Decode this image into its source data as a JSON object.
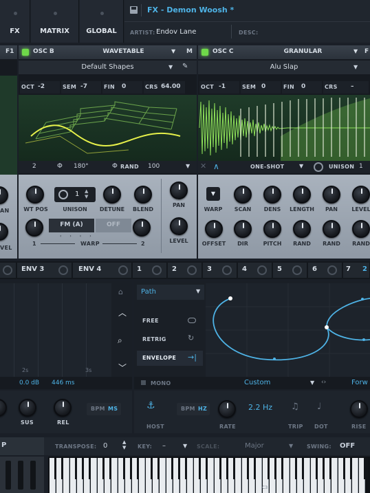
{
  "top_tabs": [
    {
      "label": "FX"
    },
    {
      "label": "MATRIX"
    },
    {
      "label": "GLOBAL"
    }
  ],
  "preset": {
    "name": "FX - Demon Woosh *",
    "artist_label": "ARTIST:",
    "artist": "Endov Lane",
    "desc_label": "DESC:"
  },
  "osc_left": {
    "f_label": "F1"
  },
  "osc_b": {
    "title": "OSC B",
    "type": "WAVETABLE",
    "m": "M",
    "wavetable": "Default Shapes",
    "oct_label": "OCT",
    "oct": "-2",
    "sem_label": "SEM",
    "sem": "-7",
    "fin_label": "FIN",
    "fin": "0",
    "crs_label": "CRS",
    "crs": "64.00",
    "unison_voices": "2",
    "phase": "180°",
    "rand_label": "RAND",
    "rand": "100",
    "knobs": [
      "WT POS",
      "UNISON",
      "DETUNE",
      "BLEND",
      "PAN",
      "LEVEL"
    ],
    "unison_count": "1",
    "warp_label": "WARP",
    "warp_mode_1": "FM (A)",
    "warp_mode_2": "OFF",
    "warp_1": "1",
    "warp_2": "2"
  },
  "osc_c": {
    "title": "OSC C",
    "type": "GRANULAR",
    "f_label": "F",
    "sample": "Alu Slap",
    "oct_label": "OCT",
    "oct": "-1",
    "sem_label": "SEM",
    "sem": "0",
    "fin_label": "FIN",
    "fin": "0",
    "crs_label": "CRS",
    "crs": "–",
    "mode": "ONE-SHOT",
    "unison_label": "UNISON",
    "unison": "1",
    "knobs_row1": [
      "WARP",
      "SCAN",
      "DENS",
      "LENGTH",
      "PAN",
      "LEVEL"
    ],
    "knobs_row2": [
      "OFFSET",
      "DIR",
      "PITCH",
      "RAND",
      "RAND",
      "RAND"
    ]
  },
  "left_fragments": {
    "an": "AN",
    "vel": "VEL"
  },
  "mod_tabs": [
    {
      "label": "ENV 3"
    },
    {
      "label": "ENV 4"
    },
    {
      "label": "1"
    },
    {
      "label": "2"
    },
    {
      "label": "3"
    },
    {
      "label": "4"
    },
    {
      "label": "5"
    },
    {
      "label": "6"
    },
    {
      "label": "7"
    },
    {
      "label": "2"
    }
  ],
  "env": {
    "t1": "2s",
    "t2": "3s",
    "db": "0.0 dB",
    "ms": "446 ms",
    "knobs": [
      "SUS",
      "REL"
    ],
    "bpm": "BPM",
    "ms_label": "MS"
  },
  "lfo": {
    "path": "Path",
    "free": "FREE",
    "retrig": "RETRIG",
    "envelope": "ENVELOPE",
    "mono": "MONO",
    "preset": "Custom",
    "direction": "Forw",
    "host": "HOST",
    "bpm": "BPM",
    "hz": "HZ",
    "rate_value": "2.2 Hz",
    "rate": "RATE",
    "trip": "TRIP",
    "dot": "DOT",
    "rise": "RISE"
  },
  "keyboard_bar": {
    "left": "P",
    "transpose_label": "TRANSPOSE:",
    "transpose": "0",
    "key_label": "KEY:",
    "key": "–",
    "scale_label": "SCALE:",
    "scale": "Major",
    "swing_label": "SWING:",
    "swing": "OFF",
    "c_label": "C3"
  }
}
